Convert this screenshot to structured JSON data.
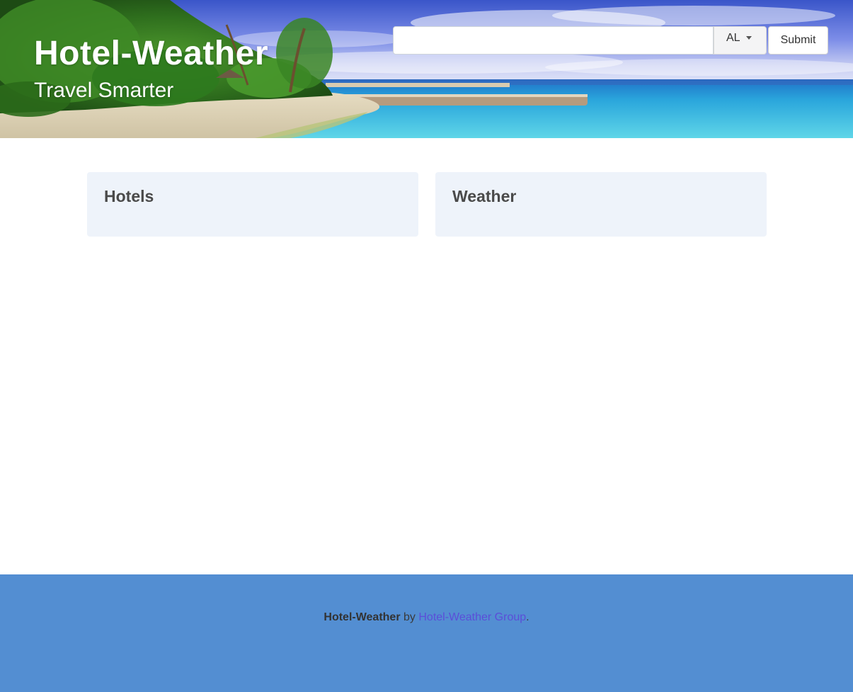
{
  "hero": {
    "title": "Hotel-Weather",
    "subtitle": "Travel Smarter"
  },
  "search": {
    "input_value": "",
    "state_selected": "AL",
    "submit_label": "Submit"
  },
  "cards": {
    "hotels_title": "Hotels",
    "weather_title": "Weather"
  },
  "footer": {
    "brand": "Hotel-Weather",
    "by": " by ",
    "link_text": "Hotel-Weather Group",
    "period": "."
  },
  "colors": {
    "footer_bg": "#538ed2",
    "card_bg": "#eef3fa",
    "link": "#5b4ed8",
    "sea": "#2fb8e0",
    "sky": "#3f5fd6"
  },
  "icons": {
    "dropdown": "chevron-down-icon"
  }
}
